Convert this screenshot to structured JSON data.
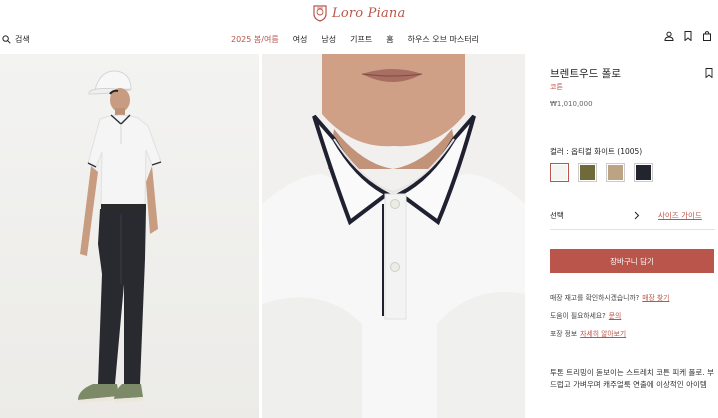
{
  "brand": {
    "name": "Loro Piana"
  },
  "header": {
    "search_label": "검색",
    "nav": [
      {
        "label": "2025 봄/여름",
        "active": true
      },
      {
        "label": "여성"
      },
      {
        "label": "남성"
      },
      {
        "label": "기프트"
      },
      {
        "label": "홈"
      },
      {
        "label": "하우스 오브 마스터리"
      }
    ],
    "icons": [
      "user-icon",
      "bookmark-icon",
      "shopping-bag-icon"
    ]
  },
  "product": {
    "title": "브렌트우드 폴로",
    "subtitle": "코튼",
    "price": "₩1,010,000",
    "color_label": "컬러 : 옵티컬 화이트 (1005)",
    "swatches": [
      {
        "name": "optical-white",
        "hex": "#f4f4f2",
        "selected": true
      },
      {
        "name": "olive",
        "hex": "#6e6a3a"
      },
      {
        "name": "beige",
        "hex": "#bba383"
      },
      {
        "name": "navy",
        "hex": "#23252e"
      }
    ],
    "select_label": "선택",
    "size_guide_label": "사이즈 가이드",
    "add_to_cart_label": "장바구니 담기",
    "store_question": "매장 재고를 확인하시겠습니까?",
    "store_link": "매장 찾기",
    "help_question": "도움이 필요하세요?",
    "help_link": "문의",
    "packaging_question": "포장 정보",
    "packaging_link": "자세히 알아보기",
    "description": "투톤 트리밍이 돋보이는 스트레치 코튼 피케 폴로. 부드럽고 가벼우며 캐주얼룩 연출에 이상적인 아이템"
  },
  "colors": {
    "accent": "#b9554a",
    "text": "#222222"
  }
}
